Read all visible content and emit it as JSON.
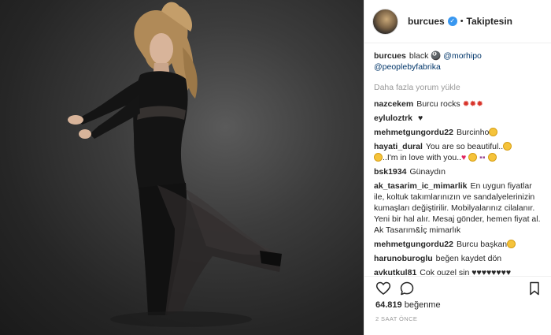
{
  "header": {
    "username": "burcues",
    "separator": "•",
    "follow_state": "Takiptesin"
  },
  "caption": {
    "username": "burcues",
    "text": "black",
    "mention1": "@morhipo",
    "mention2": "@peoplebyfabrika"
  },
  "load_more": "Daha fazla yorum yükle",
  "comments": [
    {
      "user": "nazcekem",
      "text": "Burcu rocks"
    },
    {
      "user": "eyluloztrk",
      "text": ""
    },
    {
      "user": "mehmetgungordu22",
      "text": "Burcinho"
    },
    {
      "user": "hayati_dural",
      "text": "You are so beautiful..",
      "text2": "..I'm in love with you.."
    },
    {
      "user": "bsk1934",
      "text": "Günaydın"
    },
    {
      "user": "ak_tasarim_ic_mimarlik",
      "text": "En uygun fiyatlar ile, koltuk takımlarınızın ve sandalyelerinizin kumaşları değiştirilir. Mobilyalarınız cilalanır. Yeni bir hal alır. Mesaj gönder, hemen fiyat al. Ak Tasarım&İç mimarlık"
    },
    {
      "user": "mehmetgungordu22",
      "text": "Burcu başkan"
    },
    {
      "user": "harunoburoglu",
      "text": "beğen kaydet dön"
    },
    {
      "user": "avkutkul81",
      "text": "Cok ouzel sin"
    }
  ],
  "likes": {
    "count": "64.819",
    "label": "beğenme"
  },
  "time": "2 SAAT ÖNCE",
  "icons": [
    "verified-icon",
    "heart-icon",
    "comment-icon",
    "bookmark-icon"
  ]
}
